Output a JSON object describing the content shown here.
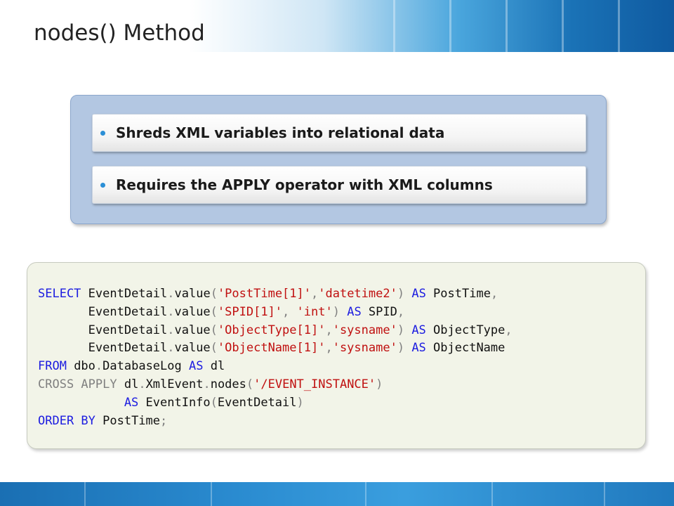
{
  "slide": {
    "title": "nodes() Method",
    "bullets": [
      "Shreds XML variables into relational data",
      "Requires the APPLY operator with XML columns"
    ]
  },
  "code_lines": [
    [
      {
        "t": "SELECT",
        "c": "kw"
      },
      {
        "t": " EventDetail",
        "c": ""
      },
      {
        "t": ".",
        "c": "gr"
      },
      {
        "t": "value",
        "c": ""
      },
      {
        "t": "(",
        "c": "gr"
      },
      {
        "t": "'PostTime[1]'",
        "c": "str"
      },
      {
        "t": ",",
        "c": "gr"
      },
      {
        "t": "'datetime2'",
        "c": "str"
      },
      {
        "t": ")",
        "c": "gr"
      },
      {
        "t": " AS",
        "c": "kw"
      },
      {
        "t": " PostTime",
        "c": ""
      },
      {
        "t": ",",
        "c": "gr"
      }
    ],
    [
      {
        "t": "       EventDetail",
        "c": ""
      },
      {
        "t": ".",
        "c": "gr"
      },
      {
        "t": "value",
        "c": ""
      },
      {
        "t": "(",
        "c": "gr"
      },
      {
        "t": "'SPID[1]'",
        "c": "str"
      },
      {
        "t": ", ",
        "c": "gr"
      },
      {
        "t": "'int'",
        "c": "str"
      },
      {
        "t": ")",
        "c": "gr"
      },
      {
        "t": " AS",
        "c": "kw"
      },
      {
        "t": " SPID",
        "c": ""
      },
      {
        "t": ",",
        "c": "gr"
      }
    ],
    [
      {
        "t": "       EventDetail",
        "c": ""
      },
      {
        "t": ".",
        "c": "gr"
      },
      {
        "t": "value",
        "c": ""
      },
      {
        "t": "(",
        "c": "gr"
      },
      {
        "t": "'ObjectType[1]'",
        "c": "str"
      },
      {
        "t": ",",
        "c": "gr"
      },
      {
        "t": "'sysname'",
        "c": "str"
      },
      {
        "t": ")",
        "c": "gr"
      },
      {
        "t": " AS",
        "c": "kw"
      },
      {
        "t": " ObjectType",
        "c": ""
      },
      {
        "t": ",",
        "c": "gr"
      }
    ],
    [
      {
        "t": "       EventDetail",
        "c": ""
      },
      {
        "t": ".",
        "c": "gr"
      },
      {
        "t": "value",
        "c": ""
      },
      {
        "t": "(",
        "c": "gr"
      },
      {
        "t": "'ObjectName[1]'",
        "c": "str"
      },
      {
        "t": ",",
        "c": "gr"
      },
      {
        "t": "'sysname'",
        "c": "str"
      },
      {
        "t": ")",
        "c": "gr"
      },
      {
        "t": " AS",
        "c": "kw"
      },
      {
        "t": " ObjectName",
        "c": ""
      }
    ],
    [
      {
        "t": "FROM",
        "c": "kw"
      },
      {
        "t": " dbo",
        "c": ""
      },
      {
        "t": ".",
        "c": "gr"
      },
      {
        "t": "DatabaseLog ",
        "c": ""
      },
      {
        "t": "AS",
        "c": "kw"
      },
      {
        "t": " dl",
        "c": ""
      }
    ],
    [
      {
        "t": "CROSS APPLY",
        "c": "gr"
      },
      {
        "t": " dl",
        "c": ""
      },
      {
        "t": ".",
        "c": "gr"
      },
      {
        "t": "XmlEvent",
        "c": ""
      },
      {
        "t": ".",
        "c": "gr"
      },
      {
        "t": "nodes",
        "c": ""
      },
      {
        "t": "(",
        "c": "gr"
      },
      {
        "t": "'/EVENT_INSTANCE'",
        "c": "str"
      },
      {
        "t": ")",
        "c": "gr"
      }
    ],
    [
      {
        "t": "            AS",
        "c": "kw"
      },
      {
        "t": " EventInfo",
        "c": ""
      },
      {
        "t": "(",
        "c": "gr"
      },
      {
        "t": "EventDetail",
        "c": ""
      },
      {
        "t": ")",
        "c": "gr"
      }
    ],
    [
      {
        "t": "ORDER BY",
        "c": "kw"
      },
      {
        "t": " PostTime",
        "c": ""
      },
      {
        "t": ";",
        "c": "gr"
      }
    ]
  ],
  "colors": {
    "keyword": "#1c1ce0",
    "string": "#c01010",
    "operator": "#808080",
    "bullet_dot": "#2b8fd6",
    "panel_blue": "#b3c7e2",
    "code_background": "#f2f4e8"
  }
}
